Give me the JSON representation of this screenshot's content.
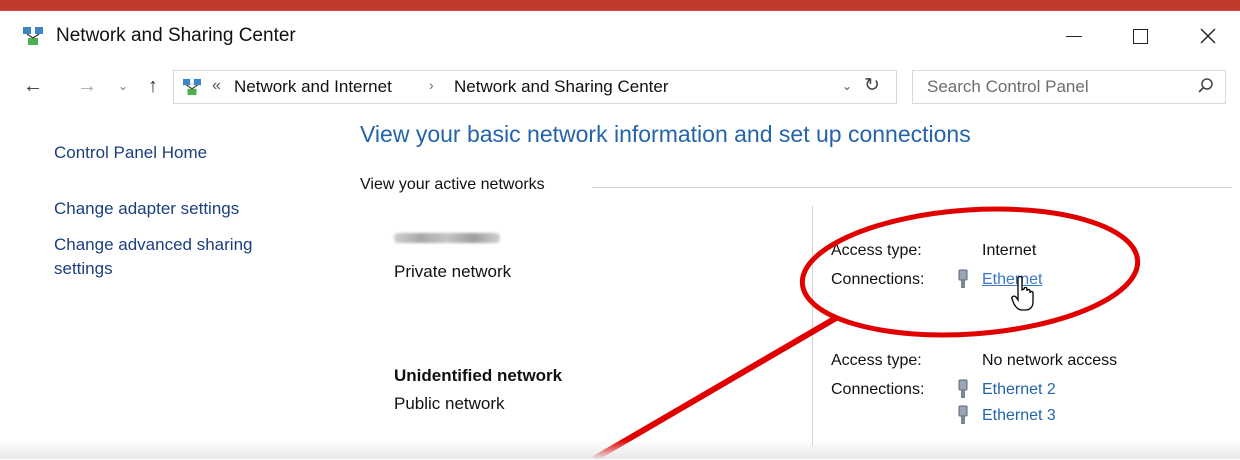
{
  "window": {
    "title": "Network and Sharing Center",
    "controls": {
      "minimize": "–",
      "maximize": "☐",
      "close": "✕"
    }
  },
  "address": {
    "overflow": "«",
    "crumbs": [
      "Network and Internet",
      "Network and Sharing Center"
    ],
    "separator": "›",
    "dropdown": "⌄",
    "refresh": "↻"
  },
  "nav": {
    "back": "←",
    "forward": "→",
    "recent": "⌄",
    "up": "↑"
  },
  "search": {
    "placeholder": "Search Control Panel"
  },
  "sidebar": {
    "items": [
      {
        "label": "Control Panel Home"
      },
      {
        "label": "Change adapter settings"
      },
      {
        "label": "Change advanced sharing settings"
      }
    ]
  },
  "main": {
    "heading": "View your basic network information and set up connections",
    "section_label": "View your active networks",
    "networks": [
      {
        "name": "",
        "name_obscured": true,
        "type": "Private network",
        "access_label": "Access type:",
        "access_value": "Internet",
        "connections_label": "Connections:",
        "connections": [
          "Ethernet"
        ]
      },
      {
        "name": "Unidentified network",
        "type": "Public network",
        "access_label": "Access type:",
        "access_value": "No network access",
        "connections_label": "Connections:",
        "connections": [
          "Ethernet 2",
          "Ethernet 3"
        ]
      }
    ]
  },
  "colors": {
    "link": "#2364aa",
    "heading": "#2364aa",
    "annotation": "#e00000"
  },
  "icons": [
    "network-center-icon",
    "search-icon",
    "ethernet-plug-icon",
    "hand-cursor-icon"
  ]
}
